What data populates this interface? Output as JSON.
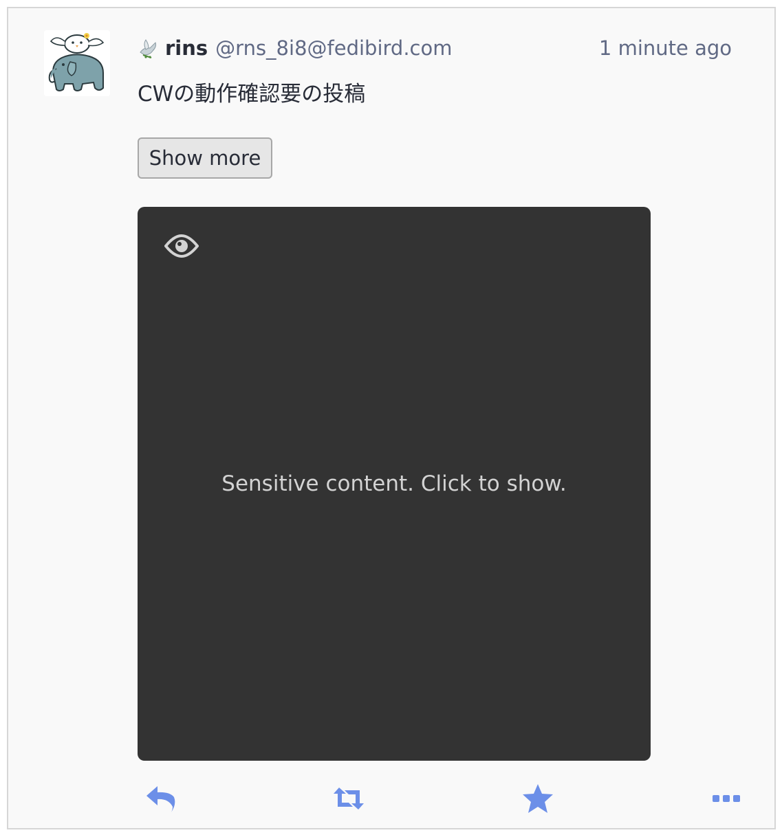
{
  "status": {
    "account": {
      "display_name": "rins",
      "acct": "@rns_8i8@fedibird.com",
      "avatar_icon": "elephant-avatar-icon",
      "badge_icon": "dove-icon"
    },
    "timestamp": "1 minute ago",
    "spoiler_text": "CWの動作確認要の投稿",
    "show_more_label": "Show more",
    "media": {
      "sensitive_label": "Sensitive content. Click to show.",
      "toggle_icon": "eye-icon",
      "background_color": "#333333"
    },
    "actions": {
      "reply_icon": "reply-icon",
      "boost_icon": "boost-icon",
      "favourite_icon": "star-icon",
      "more_icon": "ellipsis-icon"
    }
  },
  "colors": {
    "card_background": "#f9f9f9",
    "text_primary": "#282c37",
    "text_secondary": "#606984",
    "action_accent": "#6c8fe8"
  }
}
